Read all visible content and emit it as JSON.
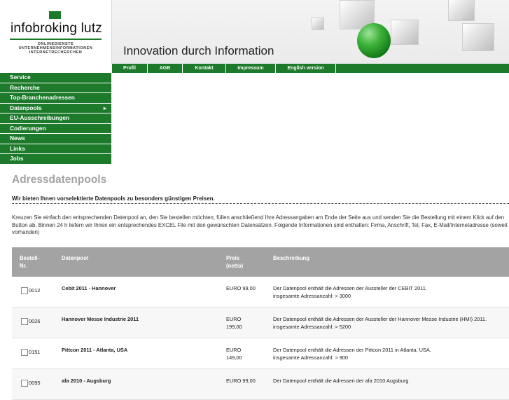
{
  "logo": {
    "name": "infobroking lutz",
    "subtitle": [
      "ONLINEDIENSTE",
      "UNTERNEHMENSINFORMATIONEN",
      "INTERNETRECHERCHEN"
    ]
  },
  "banner": {
    "slogan": "Innovation durch Information"
  },
  "topnav": [
    {
      "label": "Profil"
    },
    {
      "label": "AGB"
    },
    {
      "label": "Kontakt"
    },
    {
      "label": "Impressum"
    },
    {
      "label": "English version"
    }
  ],
  "sidebar": [
    {
      "label": "Service"
    },
    {
      "label": "Recherche"
    },
    {
      "label": "Top-Branchenadressen"
    },
    {
      "label": "Datenpools",
      "arrow": "▸"
    },
    {
      "label": "EU-Ausschreibungen"
    },
    {
      "label": "Codierungen"
    },
    {
      "label": "News"
    },
    {
      "label": "Links"
    },
    {
      "label": "Jobs"
    }
  ],
  "page": {
    "title": "Adressdatenpools",
    "lead": "Wir bieten Ihnen vorselektierte Datenpools zu besonders günstigen Preisen.",
    "intro": "Kreuzen Sie einfach den entsprechenden Datenpool an, den Sie bestellen möchten, füllen anschließend Ihre Adressangaben am Ende der Seite aus und senden Sie die Bestellung mit einem Klick auf den Button ab. Binnen 24 h liefern wir Ihnen ein entsprechendes EXCEL File mit den gewünschten Datensätzen. Folgende Informationen sind enthalten: Firma, Anschrift, Tel, Fax, E-Mail/Internetadresse (soweit vorhanden)"
  },
  "table": {
    "headers": {
      "nr_line1": "Bestell-",
      "nr_line2": "Nr.",
      "pool": "Datenpool",
      "price_line1": "Preis",
      "price_line2": "(netto)",
      "desc": "Beschreibung"
    },
    "rows": [
      {
        "nr": "0012",
        "pool": "Cebit 2011 - Hannover",
        "price1": "EURO 99,00",
        "price2": "",
        "desc1": "Der Datenpool enthält die Adressen der Aussteller der CEBIT 2011.",
        "desc2": "insgesamte Adressanzahl: > 3000"
      },
      {
        "nr": "0026",
        "pool": "Hannover Messe Industrie 2011",
        "price1": "EURO",
        "price2": "199,00",
        "desc1": "Der Datenpool enthält die Adressen der Aussteller der Hannover Messe Industrie (HMI) 2011.",
        "desc2": "insgesamte Adressanzahl: > 5200"
      },
      {
        "nr": "0151",
        "pool": "Pittcon 2011 - Atlanta, USA",
        "price1": "EURO",
        "price2": "149,00",
        "desc1": "Der Datenpool enthält die Adressen der Pittcon 2011 in Atlanta, USA.",
        "desc2": "insgesamte Adressanzahl: > 900"
      },
      {
        "nr": "0095",
        "pool": "afa 2010 - Augsburg",
        "price1": "EURO 99,00",
        "price2": "",
        "desc1": "Der Datenpool enthält die Adressen der afa 2010 Augsburg",
        "desc2": ""
      }
    ]
  },
  "colors": {
    "brand_green": "#1c7a2a",
    "header_gray": "#a3a3a3",
    "title_gray": "#a3a3a3"
  }
}
